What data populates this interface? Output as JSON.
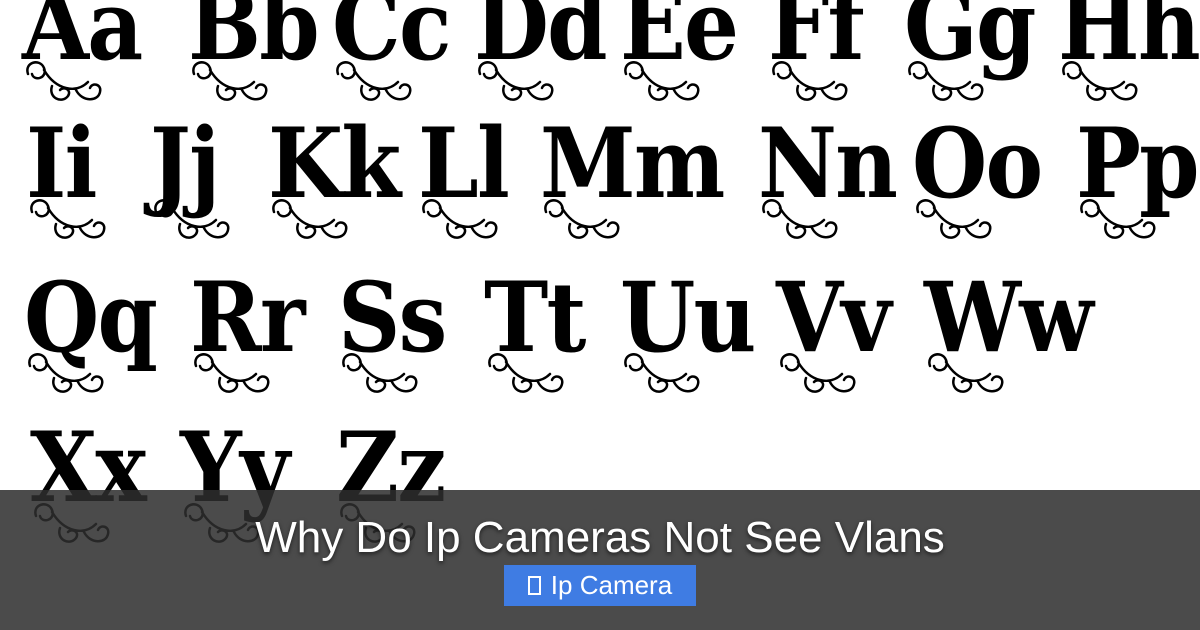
{
  "specimen": {
    "rows": [
      [
        "Aa",
        "Bb",
        "Cc",
        "Dd",
        "Ee",
        "Ff",
        "Gg",
        "Hh"
      ],
      [
        "Ii",
        "Jj",
        "Kk",
        "Ll",
        "Mm",
        "Nn",
        "Oo",
        "Pp"
      ],
      [
        "Qq",
        "Rr",
        "Ss",
        "Tt",
        "Uu",
        "Vv",
        "Ww"
      ],
      [
        "Xx",
        "Yy",
        "Zz"
      ]
    ]
  },
  "banner": {
    "title": "Why Do Ip Cameras Not See Vlans",
    "tag": {
      "label": "Ip Camera",
      "icon": "folder-icon"
    }
  },
  "colors": {
    "banner_background": "#2d2d2d",
    "tag_background": "#3f7ce3",
    "glyph": "#000000"
  }
}
